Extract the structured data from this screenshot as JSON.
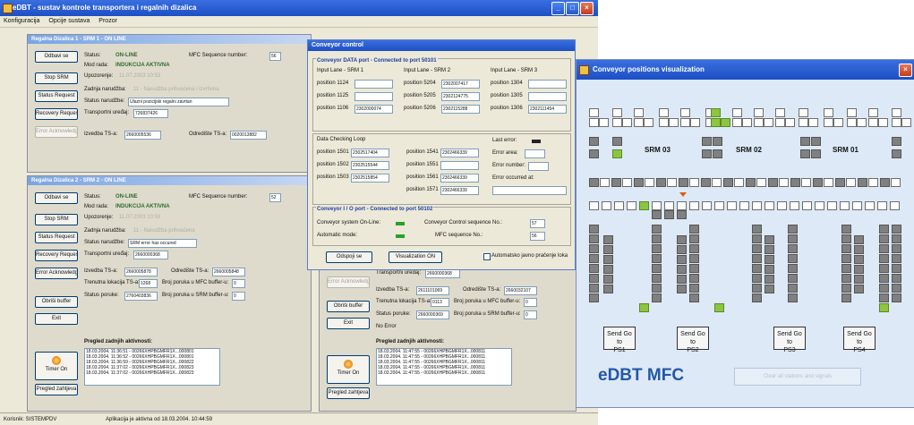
{
  "main_window": {
    "title": "eDBT - sustav kontrole transportera i regalnih dizalica",
    "menu": [
      "Konfiguracija",
      "Opcije sustava",
      "Prozor"
    ],
    "status_left": "Korisnik: SISTEMPDV",
    "status_right": "Aplikacija je aktivna od 18.03.2004. 10:44:59"
  },
  "panel1": {
    "title": "Regalna Dizalica 1 - SRM 1 - ON LINE",
    "buttons": [
      "Odbavi se",
      "Stop SRM",
      "Status Request",
      "Recovery Request",
      "Error Acknowledge"
    ],
    "status_label": "Status:",
    "status_value": "ON-LINE",
    "mfc_label": "MFC Sequence number:",
    "mfc_value": "56",
    "mode_label": "Mod rada:",
    "mode_value": "INDUKCIJA AKTIVNA",
    "upozorenje_label": "Upozorenje:",
    "upozorenje_value": "11.07.2003 10:53",
    "zadnja_label": "Zadnja narudžba:",
    "zadnja_value": "11 - Narudžba prihvaćena i izvršena",
    "ukupno_label": "Status narudžbe:",
    "ukupno_value": "Ulazni pozicijski regalni zavrtan",
    "transport_label": "Transportni uređaj:",
    "transport_value": "726837426",
    "izvedba_label": "Izvedba TS-a:",
    "izvedba_value": "2660005536",
    "odredite_label": "Odredište TS-a:",
    "odredite_value": "0020013882"
  },
  "panel2": {
    "title": "Regalna Dizalica 2 - SRM 2 - ON LINE",
    "buttons": [
      "Odbavi se",
      "Stop SRM",
      "Status Request",
      "Recovery Request",
      "Error Acknowledge",
      "Obriši buffer",
      "Exit"
    ],
    "status_label": "Status:",
    "status_value": "ON-LINE",
    "mfc_label": "MFC Sequence number:",
    "mfc_value": "52",
    "mode_label": "Mod rada:",
    "mode_value": "INDUKCIJA AKTIVNA",
    "upozorenje_label": "Upozorenje:",
    "upozorenje_value": "11.07.2003 10:53",
    "zadnja_label": "Zadnja narudžba:",
    "zadnja_value": "11 - Narudžba prihvaćena",
    "ukupno_label": "Status narudžbe:",
    "ukupno_value": "SRM error has occured",
    "transport_label": "Transportni uređaj:",
    "transport_value": "2660000368",
    "izvedba_label": "Izvedba TS-a:",
    "izvedba_value": "2660005878",
    "odredite_label": "Odredište TS-a:",
    "odredite_value": "2660005848",
    "trenutna_label": "Trenutna lokacija TS-a:",
    "trenutna_value": "1268",
    "broj_mfc_label": "Broj poruka u MFC buffer-u:",
    "broj_mfc_value": "0",
    "status_poruke_label": "Status poruke:",
    "status_poruke_value": "2760403836",
    "broj_srm_label": "Broj poruka u SRM buffer-u:",
    "broj_srm_value": "0",
    "log_title": "Pregled zadnjih aktivnosti:",
    "log": [
      "18.03.2004. 11:36:51 - 00266XHPBGMFR1X...000801",
      "18.03.2004. 11:36:52 - 00266XHPBGMFR1X...000801",
      "18.03.2004. 11:36:59 - 00266XHPBGMFR1X...000822",
      "18.03.2004. 11:37:02 - 00266XHPBGMFR1X...000823",
      "18.03.2004. 11:37:02 - 00266XHPBGMFR1X...000823"
    ],
    "timer_label": "Timer On",
    "pregled_label": "Pregled zahtjeva"
  },
  "panel3": {
    "buttons": [
      "Error Acknowledge",
      "Obriši buffer",
      "Exit"
    ],
    "transport_label": "Transportni uređaj:",
    "transport_value": "2660000368",
    "izvedba_label": "Izvedba TS-a:",
    "izvedba_value": "2611101069",
    "odredite_label": "Odredište TS-a:",
    "odredite_value": "2660032107",
    "trenutna_label": "Trenutna lokacija TS-a:",
    "trenutna_value": "0113",
    "broj_mfc_label": "Broj poruka u MFC buffer-u:",
    "broj_mfc_value": "0",
    "status_poruke_label": "Status poruke:",
    "status_poruke_value": "2660000369",
    "broj_srm_label": "Broj poruka u SRM buffer-u:",
    "broj_srm_value": "0",
    "no_error": "No Error",
    "log_title": "Pregled zadnjih aktivnosti:",
    "log": [
      "18.03.2004. 11:47:55 - 00266XHPBGMFR1X...000811",
      "18.03.2004. 11:47:55 - 00266XHPBGMFR1X...000811",
      "18.03.2004. 11:47:55 - 00266XHPBGMFR1X...000811",
      "18.03.2004. 11:47:55 - 00266XHPBGMFR1X...000811",
      "18.03.2004. 11:47:55 - 00266XHPBGMFR1X...000811"
    ],
    "timer_label": "Timer On",
    "pregled_label": "Pregled zahtjeva"
  },
  "conveyor": {
    "title": "Conveyor control",
    "data_port_title": "Conveyor DATA port - Connected to port 50101",
    "lanes": [
      {
        "label": "Input Lane - SRM 1",
        "rows": [
          {
            "label": "position 1124",
            "value": ""
          },
          {
            "label": "position 1125",
            "value": ""
          },
          {
            "label": "position 1106",
            "value": "2302000074"
          }
        ]
      },
      {
        "label": "Input Lane - SRM 2",
        "rows": [
          {
            "label": "position 5204",
            "value": "2302007417"
          },
          {
            "label": "position 5205",
            "value": "2302124775"
          },
          {
            "label": "position 5206",
            "value": "2302115288"
          }
        ]
      },
      {
        "label": "Input Lane - SRM 3",
        "rows": [
          {
            "label": "position 1304",
            "value": ""
          },
          {
            "label": "position 1305",
            "value": ""
          },
          {
            "label": "position 1306",
            "value": "2302111454"
          }
        ]
      }
    ],
    "dcl_title": "Data Checking Loop",
    "dcl_left": [
      {
        "label": "position 1501",
        "value": "2302517404"
      },
      {
        "label": "position 1502",
        "value": "2302515544"
      },
      {
        "label": "position 1503",
        "value": "2302515854"
      }
    ],
    "dcl_mid": [
      {
        "label": "position 1541",
        "value": "2302466339"
      },
      {
        "label": "position 1551",
        "value": ""
      },
      {
        "label": "position 1561",
        "value": "2302466339"
      },
      {
        "label": "position 1571",
        "value": "2302466339"
      }
    ],
    "last_error_label": "Last error:",
    "error_area_label": "Error area:",
    "error_number_label": "Error number:",
    "error_occurred_label": "Error occurred at:",
    "io_port_title": "Conveyor I / O port - Connected to port 50102",
    "online_label": "Conveyor system On-Line:",
    "automatic_label": "Automatic mode:",
    "ctrl_seq_label": "Conveyor Control sequence No.:",
    "ctrl_seq_value": "57",
    "mfc_seq_label": "MFC sequence No.:",
    "mfc_seq_value": "56",
    "btn_odspoji": "Odspoji se",
    "btn_visual": "Visualization ON",
    "chk_label": "Automatsko javno pračenje loka"
  },
  "visualization": {
    "title": "Conveyor positions visualization",
    "srm_labels": [
      "SRM 03",
      "SRM 02",
      "SRM 01"
    ],
    "send_buttons": [
      {
        "line1": "Send Go to",
        "line2": "PS1"
      },
      {
        "line1": "Send Go to",
        "line2": "PS2"
      },
      {
        "line1": "Send Go to",
        "line2": "PS3"
      },
      {
        "line1": "Send Go to",
        "line2": "PS4"
      }
    ],
    "brand": "eDBT MFC",
    "clear_button": "Clear all stations and signals"
  }
}
